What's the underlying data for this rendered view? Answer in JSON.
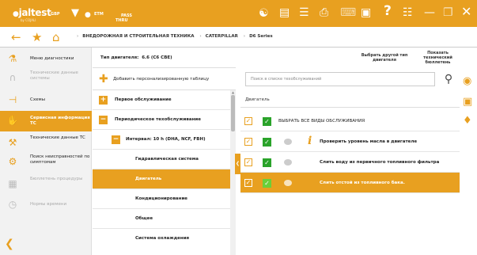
{
  "app": {
    "logo": "jaltest",
    "logo_sub": "by COJALI",
    "module_gbp": "GBP",
    "module_etm": "ETM",
    "module_pass": "PASS\nTHRU",
    "icons": [
      "wifi-status-icon",
      "document-icon",
      "list-icon",
      "printer-icon",
      "keyboard-icon",
      "camera-icon",
      "help-icon",
      "grid-icon",
      "minimize-icon",
      "restore-icon",
      "close-icon"
    ],
    "help_label": "?"
  },
  "breadcrumb": [
    "ВНЕДОРОЖНАЯ И СТРОИТЕЛЬНАЯ ТЕХНИКА",
    "CATERPILLAR",
    "D6 Series"
  ],
  "sidebar": {
    "items": [
      {
        "label": "Меню диагностики",
        "icon": "diagnostics-icon",
        "state": "normal"
      },
      {
        "label": "Технические данные системы",
        "icon": "magnet-icon",
        "state": "disabled"
      },
      {
        "label": "Схемы",
        "icon": "schematic-icon",
        "state": "normal"
      },
      {
        "label": "Сервисная информация ТС",
        "icon": "wrench-hand-icon",
        "state": "active"
      },
      {
        "label": "Технические данные ТС",
        "icon": "tools-icon",
        "state": "normal"
      },
      {
        "label": "Поиск неисправностей по симптомам",
        "icon": "troubleshoot-icon",
        "state": "normal"
      },
      {
        "label": "Бюллетень процедуры",
        "icon": "bulletin-icon",
        "state": "disabled"
      },
      {
        "label": "Нормы времени",
        "icon": "time-icon",
        "state": "disabled"
      }
    ]
  },
  "engine": {
    "label": "Тип двигателя:",
    "value": "6.6 (C6 CBE)"
  },
  "add_table_label": "Добавить персонализированную таблицу",
  "tree": [
    {
      "label": "Первое обслуживание",
      "box": "+",
      "level": 0,
      "active": false
    },
    {
      "label": "Периодическое техобслуживание",
      "box": "−",
      "level": 0,
      "active": false
    },
    {
      "label": "Интервал:   10 h (DHA, NCF, FBH)",
      "box": "−",
      "level": 1,
      "active": false
    },
    {
      "label": "Гидравлическая система",
      "box": "",
      "level": 2,
      "active": false
    },
    {
      "label": "Двигатель",
      "box": "",
      "level": 2,
      "active": true
    },
    {
      "label": "Кондиционирование",
      "box": "",
      "level": 2,
      "active": false
    },
    {
      "label": "Общее",
      "box": "",
      "level": 2,
      "active": false
    },
    {
      "label": "Система охлаждения",
      "box": "",
      "level": 2,
      "active": false
    }
  ],
  "right": {
    "change_engine_label": "Выбрать другой тип двигателя",
    "show_library_label": "Показать технический бюллетень",
    "search_placeholder": "Поиск в списке техобслуживаний",
    "column_header": "Двигатель",
    "select_all_label": "ВЫБРАТЬ ВСЕ ВИДЫ ОБСЛУЖИВАНИЯ",
    "operations": [
      {
        "label": "Проверить уровень масла в двигателе",
        "info": true,
        "active": false
      },
      {
        "label": "Слить воду из первичного топливного фильтра",
        "info": false,
        "active": false
      },
      {
        "label": "Слить отстой из топливного бака.",
        "info": false,
        "active": true
      }
    ]
  },
  "colors": {
    "accent": "#e8a020",
    "check_green": "#2aa32a"
  }
}
